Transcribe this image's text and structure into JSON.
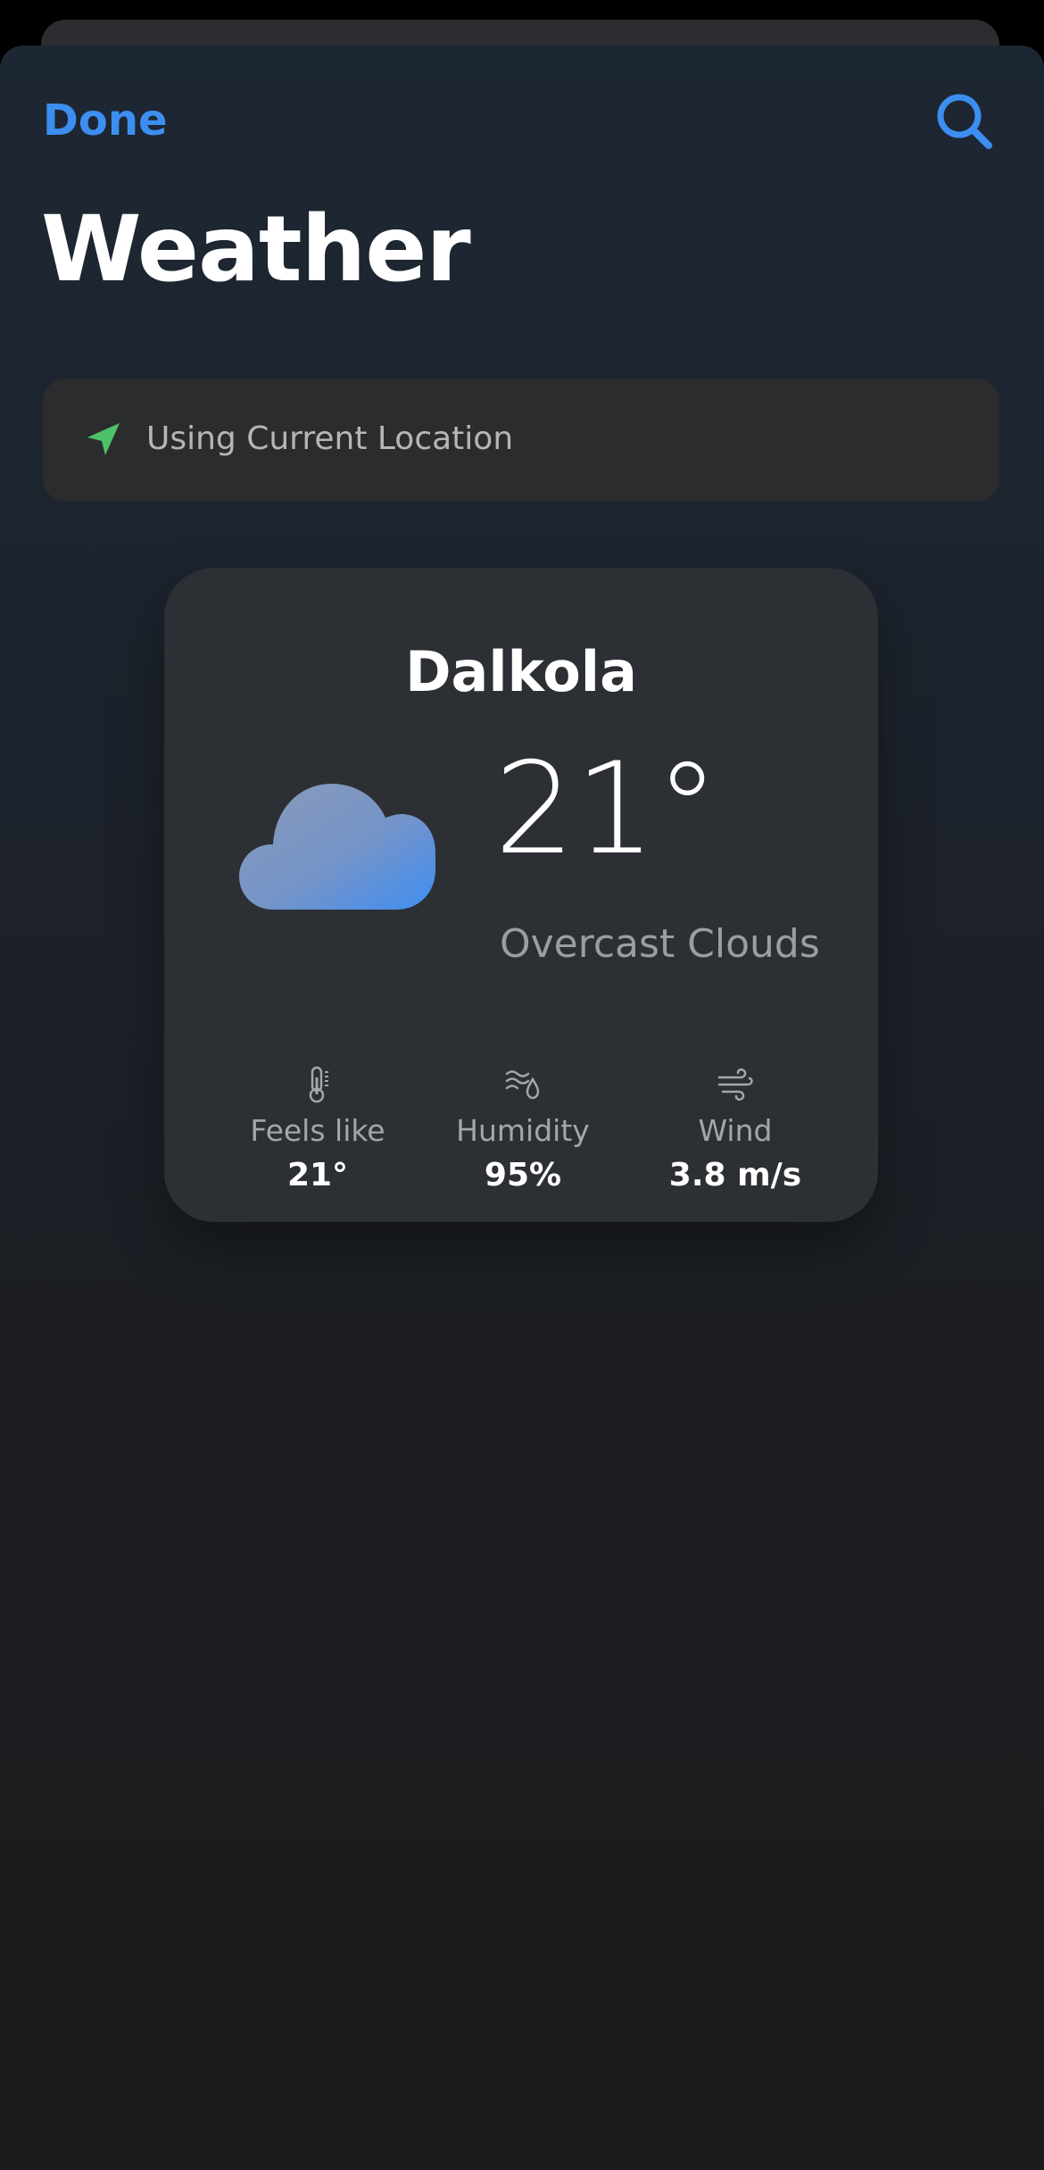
{
  "header": {
    "done_label": "Done",
    "title": "Weather"
  },
  "location": {
    "label": "Using Current Location"
  },
  "card": {
    "city": "Dalkola",
    "temperature": "21°",
    "condition": "Overcast Clouds",
    "stats": [
      {
        "label": "Feels like",
        "value": "21°",
        "icon": "thermometer-icon"
      },
      {
        "label": "Humidity",
        "value": "95%",
        "icon": "humidity-icon"
      },
      {
        "label": "Wind",
        "value": "3.8 m/s",
        "icon": "wind-icon"
      }
    ]
  },
  "colors": {
    "accent": "#3c8ef0",
    "location_arrow": "#4cc16a",
    "background_top": "#1d2733",
    "background_bottom": "#1c1c1e",
    "card": "#2c2f34"
  },
  "icons": {
    "search": "search-icon",
    "location": "location-arrow-icon",
    "weather": "cloud-icon"
  }
}
